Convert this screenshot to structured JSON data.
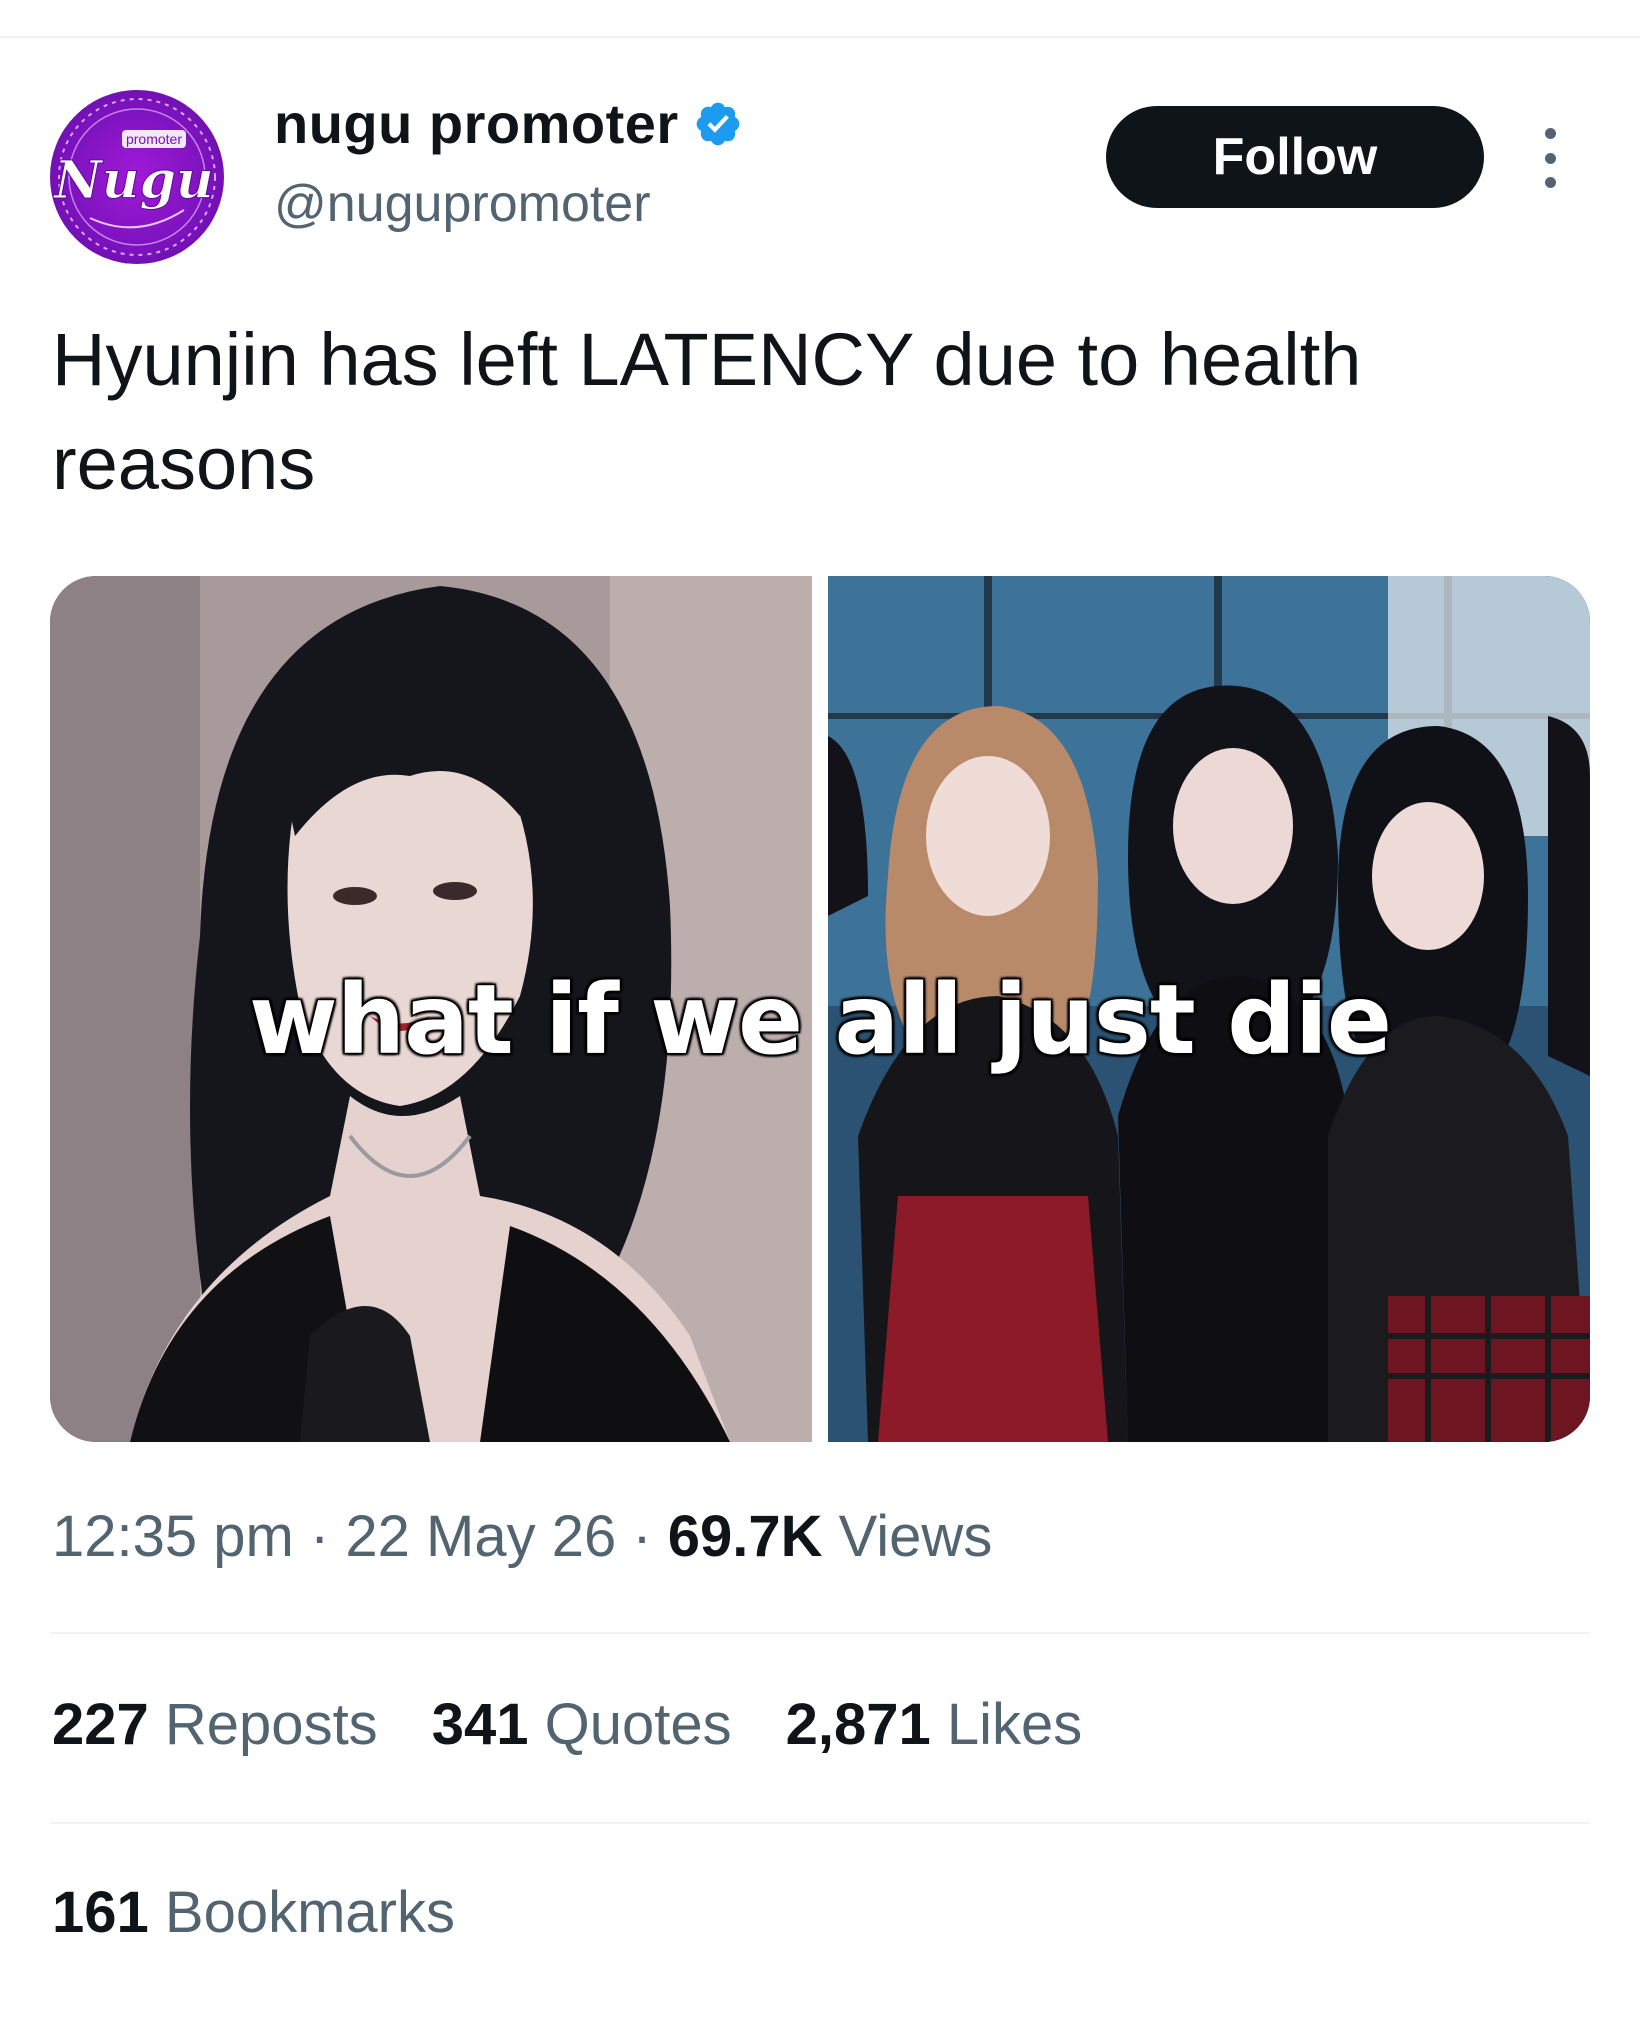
{
  "author": {
    "display_name": "nugu promoter",
    "handle": "@nugupromoter",
    "avatar_text_top": "promoter",
    "avatar_text_main": "Nugu",
    "verified": true
  },
  "follow_label": "Follow",
  "more_icon": "more-vertical-icon",
  "tweet_text": "Hyunjin has left LATENCY due to health reasons",
  "media": {
    "caption": "what if we all just die"
  },
  "meta": {
    "time": "12:35 pm",
    "separator": " · ",
    "date": "22 May 26",
    "views_count": "69.7K",
    "views_label": "Views"
  },
  "stats": {
    "reposts_count": "227",
    "reposts_label": "Reposts",
    "quotes_count": "341",
    "quotes_label": "Quotes",
    "likes_count": "2,871",
    "likes_label": "Likes"
  },
  "bookmarks": {
    "count": "161",
    "label": "Bookmarks"
  },
  "colors": {
    "text_primary": "#0f1419",
    "text_secondary": "#536471",
    "verified_blue": "#1d9bf0",
    "avatar_purple": "#8a14c9",
    "follow_bg": "#0f1419"
  }
}
